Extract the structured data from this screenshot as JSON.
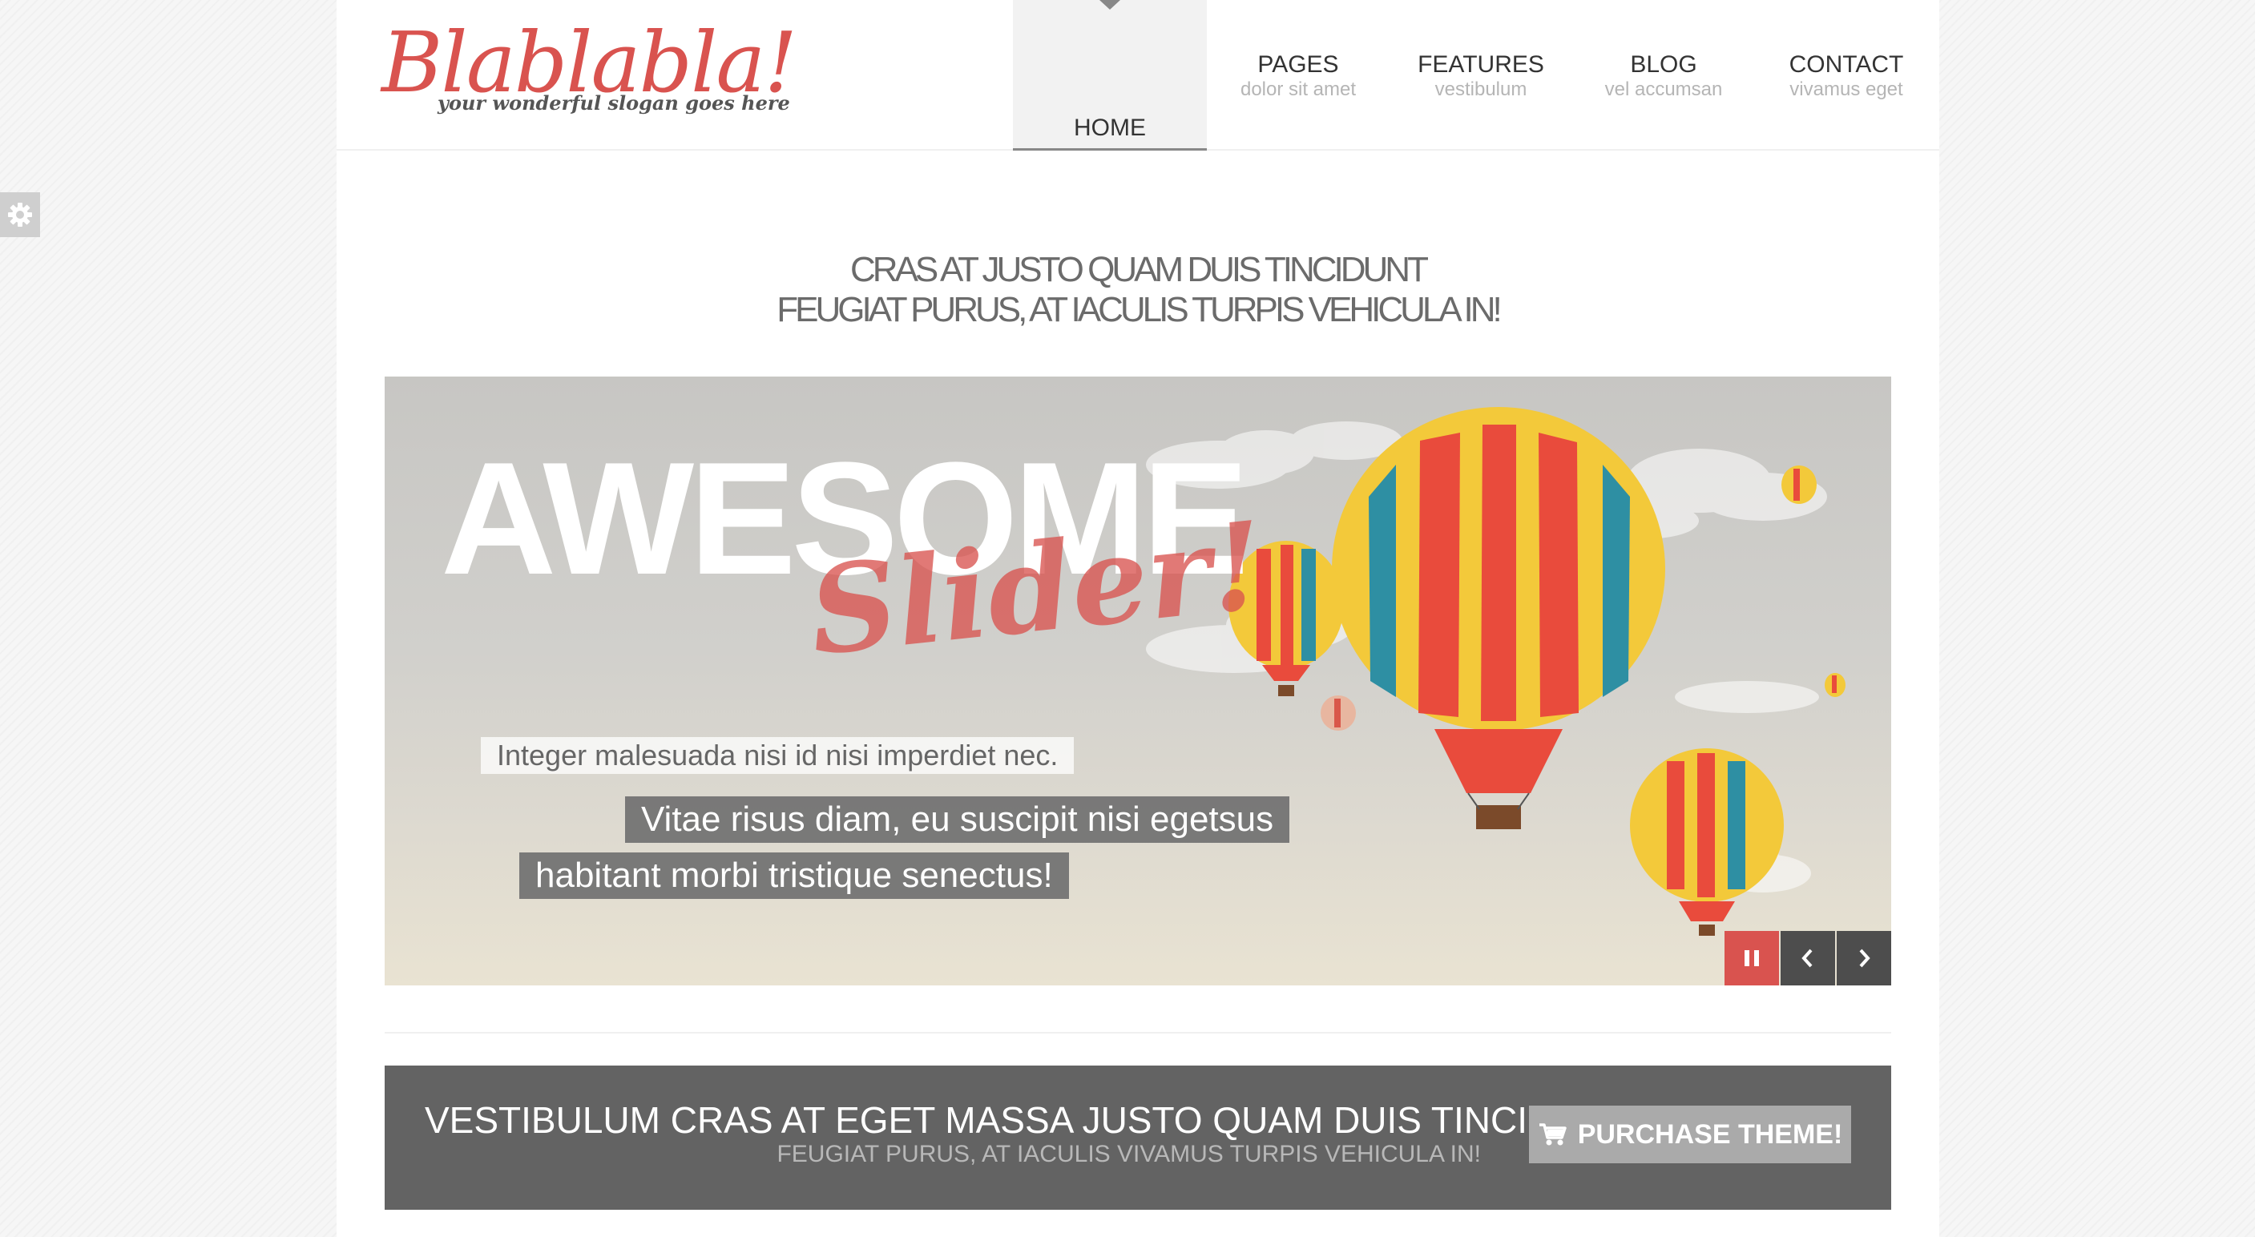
{
  "logo": {
    "text": "Blablabla!",
    "slogan": "your wonderful slogan goes here"
  },
  "nav": {
    "items": [
      {
        "label": "HOME",
        "sub": "",
        "active": true
      },
      {
        "label": "PAGES",
        "sub": "dolor sit amet"
      },
      {
        "label": "FEATURES",
        "sub": "vestibulum"
      },
      {
        "label": "BLOG",
        "sub": "vel accumsan"
      },
      {
        "label": "CONTACT",
        "sub": "vivamus eget"
      }
    ]
  },
  "headline": {
    "line1": "CRAS AT JUSTO QUAM DUIS TINCIDUNT",
    "line2": "FEUGIAT PURUS, AT IACULIS TURPIS VEHICULA IN!"
  },
  "slider": {
    "title": "AWESOME",
    "script": "Slider!",
    "caption1": "Integer malesuada nisi id nisi imperdiet nec.",
    "caption2": "Vitae risus diam, eu suscipit nisi egetsus",
    "caption3": "habitant morbi tristique senectus!",
    "controls": {
      "pause": "pause-icon",
      "prev": "chevron-left-icon",
      "next": "chevron-right-icon"
    }
  },
  "banner": {
    "title": "VESTIBULUM CRAS AT EGET MASSA JUSTO QUAM DUIS TINCIDUNT",
    "subtitle": "FEUGIAT PURUS, AT IACULIS VIVAMUS TURPIS VEHICULA IN!",
    "button": "PURCHASE THEME!",
    "button_icon": "cart-icon"
  },
  "settings_icon": "gear-icon",
  "colors": {
    "accent": "#d9534f",
    "banner": "#636363",
    "button": "#aaaaaa",
    "text": "#333333"
  }
}
